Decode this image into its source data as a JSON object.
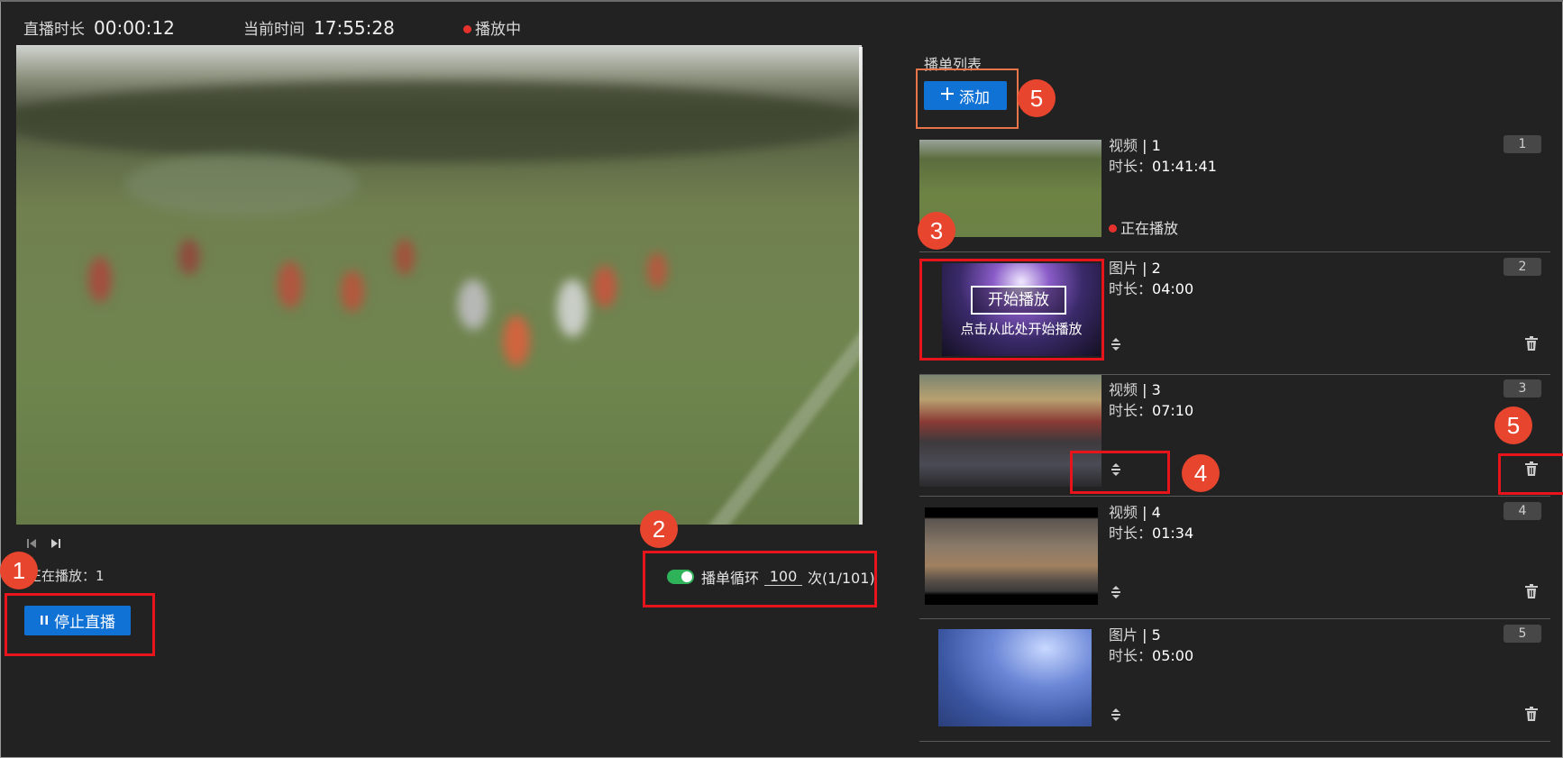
{
  "top_bar": {
    "live_duration_label": "直播时长",
    "live_duration_value": "00:00:12",
    "current_time_label": "当前时间",
    "current_time_value": "17:55:28",
    "status_text": "播放中",
    "status_color": "#e5322d"
  },
  "player": {
    "prev_icon": "skip-previous-icon",
    "next_icon": "skip-next-icon",
    "now_playing_text": "正在播放：1",
    "stop_button_label": "停止直播",
    "stop_button_icon": "pause-icon"
  },
  "loop": {
    "label": "播单循环",
    "count_value": "100",
    "suffix": "次(1/101)",
    "enabled": true
  },
  "playlist": {
    "title": "播单列表",
    "add_button_label": "添加",
    "add_button_icon": "plus-icon",
    "items": [
      {
        "type": "视频",
        "index": "1",
        "duration_label": "时长：",
        "duration": "01:41:41",
        "badge": "1",
        "status": "正在播放"
      },
      {
        "type": "图片",
        "index": "2",
        "duration_label": "时长：",
        "duration": "04:00",
        "badge": "2",
        "overlay_button": "开始播放",
        "overlay_hint": "点击从此处开始播放"
      },
      {
        "type": "视频",
        "index": "3",
        "duration_label": "时长：",
        "duration": "07:10",
        "badge": "3"
      },
      {
        "type": "视频",
        "index": "4",
        "duration_label": "时长：",
        "duration": "01:34",
        "badge": "4"
      },
      {
        "type": "图片",
        "index": "5",
        "duration_label": "时长：",
        "duration": "05:00",
        "badge": "5"
      }
    ]
  },
  "callouts": [
    "1",
    "2",
    "3",
    "4",
    "5",
    "5"
  ],
  "colors": {
    "accent": "#1172d6",
    "highlight_box": "#e8141c",
    "callout": "#e8452e",
    "toggle_on": "#2fb35a"
  }
}
